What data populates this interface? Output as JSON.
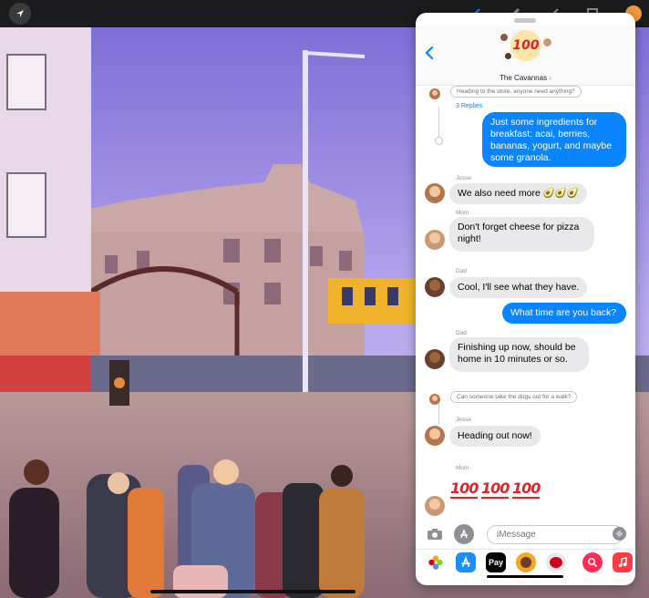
{
  "panel": {
    "group_name": "The Cavannas",
    "group_badge": "100",
    "chevron": "›"
  },
  "thread": {
    "reply_prompt_1": "Heading to the store, anyone need anything?",
    "replies_count": "3 Replies",
    "reply_prompt_2": "Can someone take the dogs out for a walk?",
    "messages": [
      {
        "sender": "",
        "text_lines": [
          "Just some ingredients for",
          "breakfast: acai, berries,",
          "bananas, yogurt, and maybe",
          "some granola."
        ]
      },
      {
        "sender": "Jesse",
        "text": "We also need more 🥑🥑🥑"
      },
      {
        "sender": "Mom",
        "text_lines": [
          "Don't forget cheese for pizza",
          "night!"
        ]
      },
      {
        "sender": "Dad",
        "text": "Cool, I'll see what they have."
      },
      {
        "sender": "",
        "text": "What time are you back?"
      },
      {
        "sender": "Dad",
        "text_lines": [
          "Finishing up now, should be",
          "home in 10 minutes or so."
        ]
      },
      {
        "sender": "Jesse",
        "text": "Heading out now!"
      },
      {
        "sender": "Mom",
        "emoji": [
          "100",
          "100",
          "100"
        ]
      }
    ]
  },
  "input": {
    "placeholder": "iMessage"
  },
  "apps": [
    {
      "name": "photos-app-icon"
    },
    {
      "name": "app-store-icon"
    },
    {
      "name": "apple-pay-icon",
      "label": "Pay"
    },
    {
      "name": "memoji-icon"
    },
    {
      "name": "animoji-icon"
    },
    {
      "name": "images-search-icon"
    },
    {
      "name": "music-icon"
    }
  ],
  "colors": {
    "accent": "#0a84ff",
    "bubble_gray": "#e9e9eb",
    "badge_red": "#e0242a"
  }
}
